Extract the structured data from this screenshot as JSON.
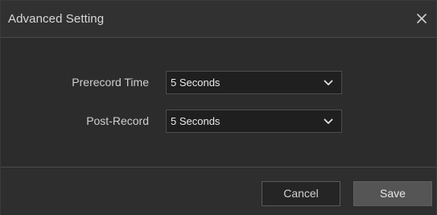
{
  "dialog": {
    "title": "Advanced Setting",
    "close_icon": "close-icon"
  },
  "fields": {
    "prerecord": {
      "label": "Prerecord Time",
      "value": "5 Seconds",
      "icon": "chevron-down-icon"
    },
    "postrecord": {
      "label": "Post-Record",
      "value": "5 Seconds",
      "icon": "chevron-down-icon"
    }
  },
  "footer": {
    "cancel_label": "Cancel",
    "save_label": "Save"
  },
  "colors": {
    "background": "#2e2e2e",
    "select_bg": "#1f1f1f",
    "save_bg": "#555555",
    "text": "#d9d9d9"
  }
}
